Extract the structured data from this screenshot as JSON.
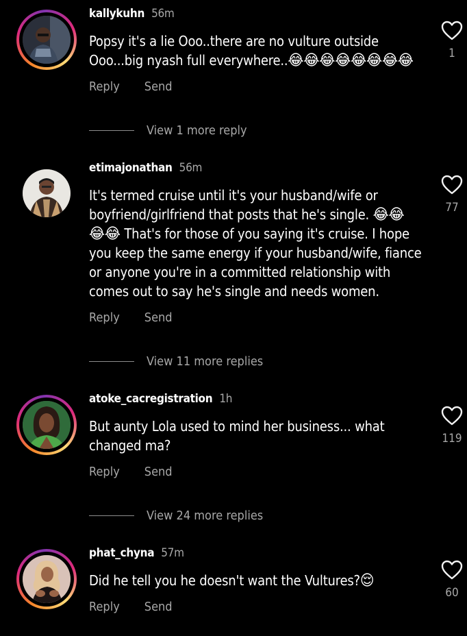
{
  "comments": [
    {
      "username": "kallykuhn",
      "time": "56m",
      "text": "Popsy it's a lie Ooo..there are no vulture outside Ooo...big nyash full everywhere..",
      "emojis": "😂😂😂😂😂😂😂😂",
      "reply_label": "Reply",
      "send_label": "Send",
      "view_more": "View 1 more reply",
      "likes": "1",
      "story_ring": true
    },
    {
      "username": "etimajonathan",
      "time": "56m",
      "text_part1": "It's termed cruise until it's your husband/wife or boyfriend/girlfriend that posts that he's single. ",
      "emojis1": "😂😂",
      "emojis2": "😂😂",
      "text_part2": " That's for those of you saying it's cruise. I hope you keep the same energy if your husband/wife, fiance or anyone you're in a committed relationship with comes out to say he's single and needs women.",
      "reply_label": "Reply",
      "send_label": "Send",
      "view_more": "View 11 more replies",
      "likes": "77",
      "story_ring": false
    },
    {
      "username": "atoke_cacregistration",
      "time": "1h",
      "text": "But aunty Lola used to mind her business... what changed ma?",
      "reply_label": "Reply",
      "send_label": "Send",
      "view_more": "View 24 more replies",
      "likes": "119",
      "story_ring": true
    },
    {
      "username": "phat_chyna",
      "time": "57m",
      "text": "Did he tell you he doesn't want the Vultures?",
      "emojis": "😌",
      "reply_label": "Reply",
      "send_label": "Send",
      "likes": "60",
      "story_ring": true
    }
  ]
}
